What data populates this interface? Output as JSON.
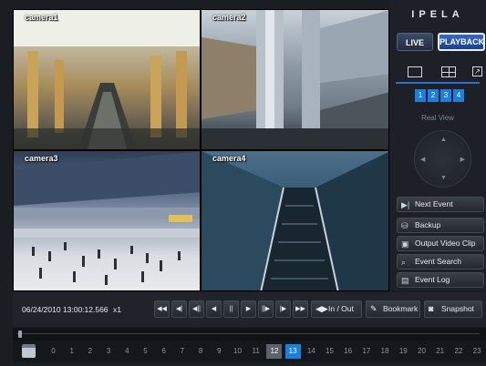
{
  "brand": {
    "logo_text": "IPELA"
  },
  "mode": {
    "live_label": "LIVE",
    "playback_label": "PLAYBACK",
    "active": "playback"
  },
  "cameras": [
    {
      "label": "camera1"
    },
    {
      "label": "camera2"
    },
    {
      "label": "camera3"
    },
    {
      "label": "camera4"
    }
  ],
  "layout": {
    "camera_numbers": [
      "1",
      "2",
      "3",
      "4"
    ],
    "real_view_label": "Real View"
  },
  "side_actions": {
    "next_event": "Next Event",
    "backup": "Backup",
    "output_video_clip": "Output Video Clip",
    "event_search": "Event Search",
    "event_log": "Event Log"
  },
  "playback": {
    "timestamp": "06/24/2010 13:00:12.566",
    "speed": "x1",
    "in_out_label": "In / Out",
    "bookmark_label": "Bookmark",
    "snapshot_label": "Snapshot"
  },
  "timeline": {
    "hours": [
      "0",
      "1",
      "2",
      "3",
      "4",
      "5",
      "6",
      "7",
      "8",
      "9",
      "10",
      "11",
      "12",
      "13",
      "14",
      "15",
      "16",
      "17",
      "18",
      "19",
      "20",
      "21",
      "22",
      "23"
    ],
    "highlighted_hour": "12",
    "selected_hour": "13"
  },
  "colors": {
    "accent_blue": "#1a7fe0",
    "panel_bg": "#1d2127"
  }
}
